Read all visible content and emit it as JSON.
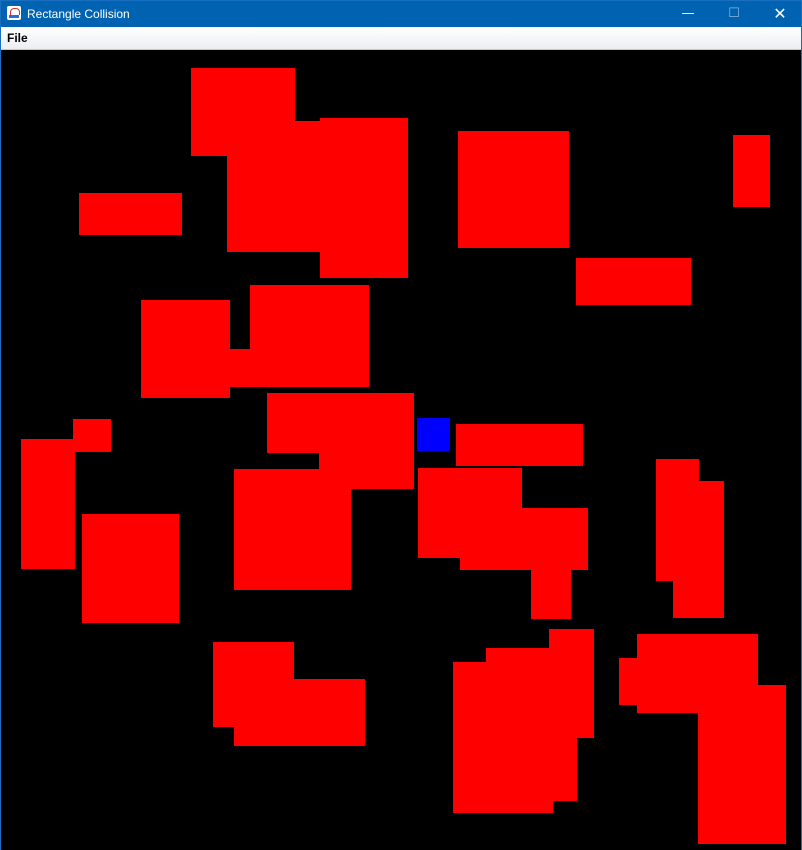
{
  "window": {
    "title": "Rectangle Collision",
    "controls": {
      "minimize": "—",
      "maximize": "☐",
      "close": "✕"
    }
  },
  "menu": {
    "file_label": "File"
  },
  "game": {
    "colors": {
      "background": "#000000",
      "obstacle": "#ff0000",
      "player": "#0000ff"
    }
  }
}
